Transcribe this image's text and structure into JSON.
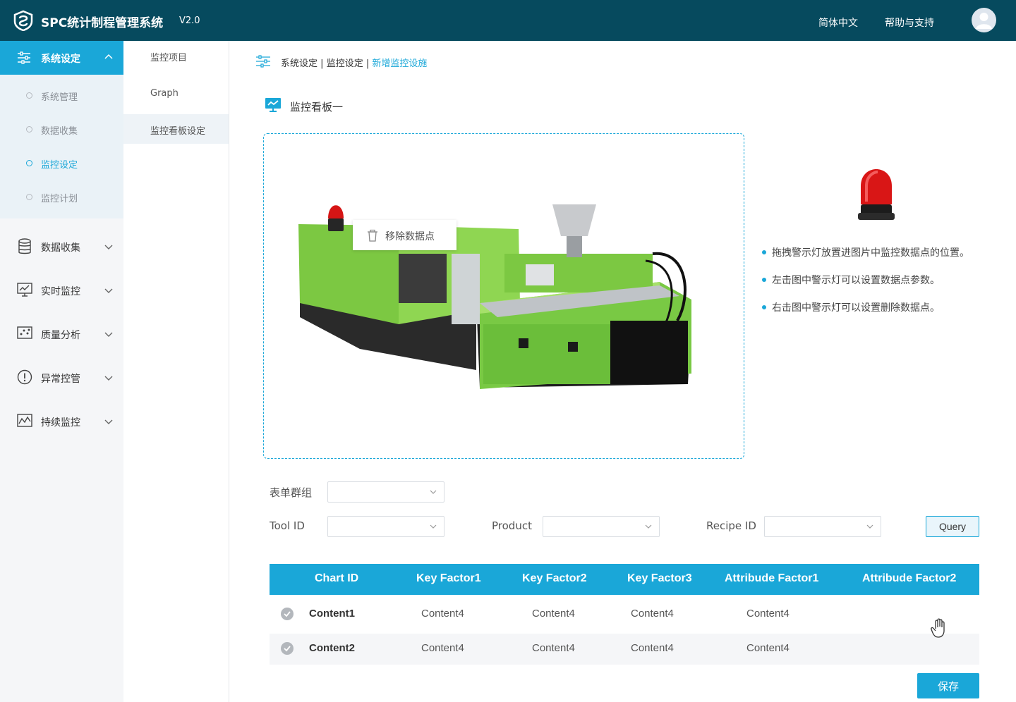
{
  "header": {
    "title": "SPC统计制程管理系统",
    "version": "V2.0",
    "lang_label": "简体中文",
    "help_label": "帮助与支持",
    "logo_icon": "spc-logo-icon",
    "avatar_icon": "user-avatar-icon",
    "bg_color": "#064a5e"
  },
  "sidebar": {
    "active_group": {
      "label": "系统设定",
      "icon": "sliders-icon"
    },
    "sub_items": [
      {
        "label": "系统管理",
        "active": false
      },
      {
        "label": "数据收集",
        "active": false
      },
      {
        "label": "监控设定",
        "active": true
      },
      {
        "label": "监控计划",
        "active": false
      }
    ],
    "groups": [
      {
        "label": "数据收集",
        "icon": "database-icon"
      },
      {
        "label": "实时监控",
        "icon": "monitor-chart-icon"
      },
      {
        "label": "质量分析",
        "icon": "scatter-analysis-icon"
      },
      {
        "label": "异常控管",
        "icon": "alert-circle-icon"
      },
      {
        "label": "持续监控",
        "icon": "continuous-monitor-icon"
      }
    ],
    "accent_color": "#1aa7d8"
  },
  "subnav": {
    "items": [
      {
        "label": "监控项目",
        "active": false
      },
      {
        "label": "Graph",
        "active": false
      },
      {
        "label": "监控看板设定",
        "active": true
      }
    ]
  },
  "breadcrumb": {
    "part1": "系统设定",
    "sep": "|",
    "part2": "监控设定",
    "current": "新增监控设施"
  },
  "panel": {
    "title": "监控看板一",
    "context_menu_label": "移除数据点",
    "tips": [
      "拖拽警示灯放置进图片中监控数据点的位置。",
      "左击图中警示灯可以设置数据点参数。",
      "右击图中警示灯可以设置删除数据点。"
    ]
  },
  "form": {
    "group_label": "表单群组",
    "tool_label": "Tool ID",
    "product_label": "Product",
    "recipe_label": "Recipe ID",
    "group_value": "",
    "tool_value": "",
    "product_value": "",
    "recipe_value": "",
    "query_label": "Query"
  },
  "table": {
    "columns": [
      "Chart ID",
      "Key Factor1",
      "Key Factor2",
      "Key Factor3",
      "Attribude Factor1",
      "Attribude Factor2"
    ],
    "rows": [
      {
        "chart_id": "Content1",
        "kf1": "Content4",
        "kf2": "Content4",
        "kf3": "Content4",
        "af1": "Content4",
        "af2": ""
      },
      {
        "chart_id": "Content2",
        "kf1": "Content4",
        "kf2": "Content4",
        "kf3": "Content4",
        "af1": "Content4",
        "af2": ""
      }
    ]
  },
  "save_label": "保存"
}
